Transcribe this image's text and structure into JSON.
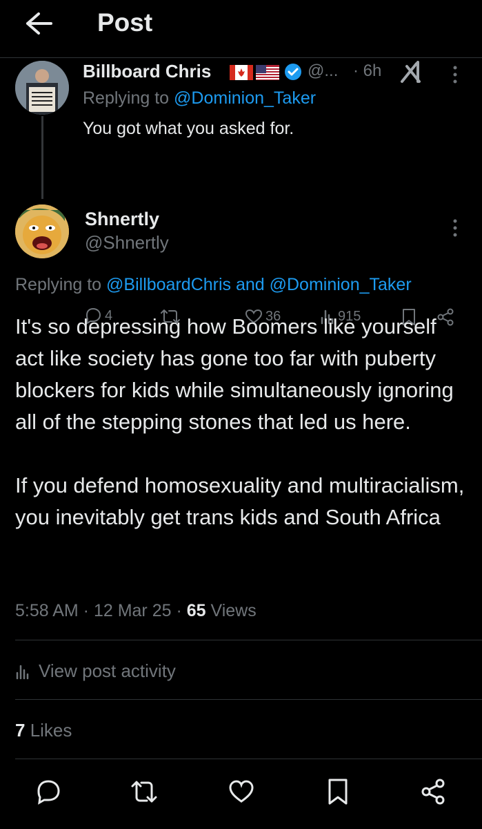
{
  "header": {
    "back_icon": "arrow-left-icon",
    "title": "Post"
  },
  "reply_tweet": {
    "name": "Billboard Chris",
    "flags": [
      "canada-flag",
      "usa-flag"
    ],
    "verified_icon": "verified-badge-icon",
    "handle": "@...",
    "time": "· 6h",
    "grok_icon": "grok-icon",
    "replying_prefix": "Replying to ",
    "replying_to": "@Dominion_Taker",
    "text": "You got what you asked for.",
    "replies": "4",
    "retweets": "",
    "likes": "36",
    "views": "915"
  },
  "main_tweet": {
    "name": "Shnertly",
    "handle": "@Shnertly",
    "replying_prefix": "Replying to ",
    "replying_to": "@BillboardChris and @Dominion_Taker",
    "paragraphs": [
      "It's so depressing how Boomers like yourself act like society has gone too far with puberty blockers for kids while simultaneously ignoring all of the stepping stones that led us here.",
      "If you defend homosexuality and multiracialism, you inevitably get trans kids and South Africa"
    ],
    "time": "5:58 AM",
    "date": "12 Mar 25",
    "views_count": "65",
    "views_label": " Views",
    "separator": " · ",
    "activity_label": "View post activity",
    "likes_count": "7",
    "likes_label": " Likes"
  },
  "colors": {
    "accent": "#1d9bf0",
    "muted": "#71767b",
    "text": "#e7e9ea",
    "divider": "#2f3336"
  }
}
